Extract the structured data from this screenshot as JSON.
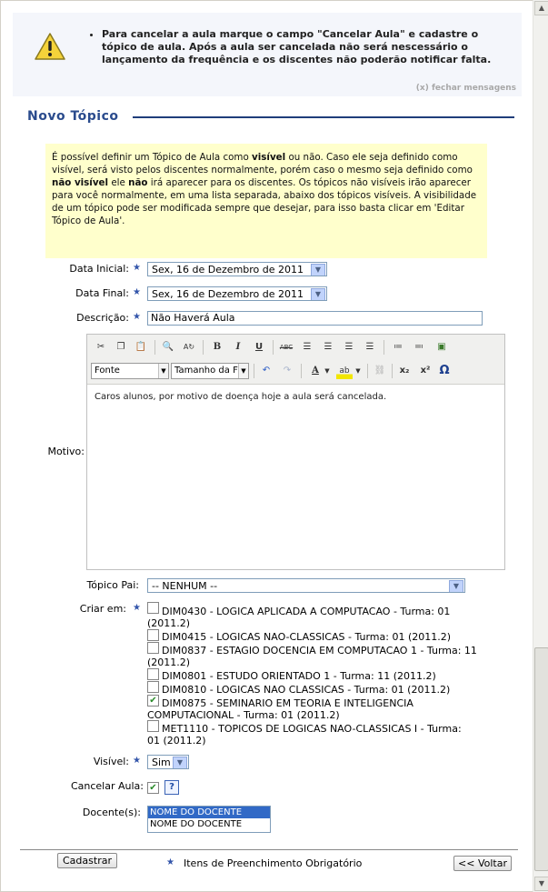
{
  "alert": {
    "icon": "warning-icon",
    "message": "Para cancelar a aula marque o campo \"Cancelar Aula\" e cadastre o tópico de aula. Após a aula ser cancelada não será nescessário o lançamento da frequência e os discentes não poderão notificar falta.",
    "close_label": "(x) fechar mensagens"
  },
  "page": {
    "title": "Novo Tópico"
  },
  "info": {
    "p1": "É possível definir um Tópico de Aula como ",
    "b1": "visível",
    "p2": " ou não. Caso ele seja definido como visível, será visto pelos discentes normalmente, porém caso o mesmo seja definido como ",
    "b2": "não visível",
    "p3": " ele ",
    "b3": "não",
    "p4": " irá aparecer para os discentes. Os tópicos não visíveis irão aparecer para você normalmente, em uma lista separada, abaixo dos tópicos visíveis. A visibilidade de um tópico pode ser modificada sempre que desejar, para isso basta clicar em 'Editar Tópico de Aula'."
  },
  "form": {
    "data_inicial": {
      "label": "Data Inicial:",
      "value": "Sex, 16 de Dezembro de 2011"
    },
    "data_final": {
      "label": "Data Final:",
      "value": "Sex, 16 de Dezembro de 2011"
    },
    "descricao": {
      "label": "Descrição:",
      "value": "Não Haverá Aula"
    },
    "motivo": {
      "label": "Motivo:",
      "content": "Caros alunos, por motivo de doença hoje a aula será cancelada."
    },
    "editor": {
      "font_label": "Fonte",
      "size_label": "Tamanho da Fo"
    },
    "topico_pai": {
      "label": "Tópico Pai:",
      "value": "-- NENHUM --"
    },
    "criar_em": {
      "label": "Criar em:",
      "courses": [
        {
          "line1": "DIM0430 - LOGICA APLICADA A COMPUTACAO - Turma: 01",
          "line2": "(2011.2)",
          "checked": false
        },
        {
          "line1": "DIM0415 - LOGICAS NAO-CLASSICAS - Turma: 01 (2011.2)",
          "line2": "",
          "checked": false
        },
        {
          "line1": "DIM0837 - ESTAGIO DOCENCIA EM COMPUTACAO 1 - Turma: 11",
          "line2": "(2011.2)",
          "checked": false
        },
        {
          "line1": "DIM0801 - ESTUDO ORIENTADO 1 - Turma: 11 (2011.2)",
          "line2": "",
          "checked": false
        },
        {
          "line1": "DIM0810 - LOGICAS NAO CLASSICAS - Turma: 01 (2011.2)",
          "line2": "",
          "checked": false
        },
        {
          "line1": "DIM0875 - SEMINARIO EM TEORIA E INTELIGENCIA",
          "line2": "COMPUTACIONAL - Turma: 01 (2011.2)",
          "checked": true
        },
        {
          "line1": "MET1110 - TOPICOS DE LOGICAS NAO-CLASSICAS I - Turma:",
          "line2": "01 (2011.2)",
          "checked": false
        }
      ]
    },
    "visivel": {
      "label": "Visível:",
      "value": "Sim"
    },
    "cancelar_aula": {
      "label": "Cancelar Aula:",
      "checked": true,
      "help": "?"
    },
    "docentes": {
      "label": "Docente(s):",
      "options": [
        "NOME DO DOCENTE",
        "NOME DO DOCENTE"
      ]
    }
  },
  "footer": {
    "submit_label": "Cadastrar",
    "required_note": "Itens de Preenchimento Obrigatório",
    "back_label": "<< Voltar",
    "required_star": "★"
  }
}
